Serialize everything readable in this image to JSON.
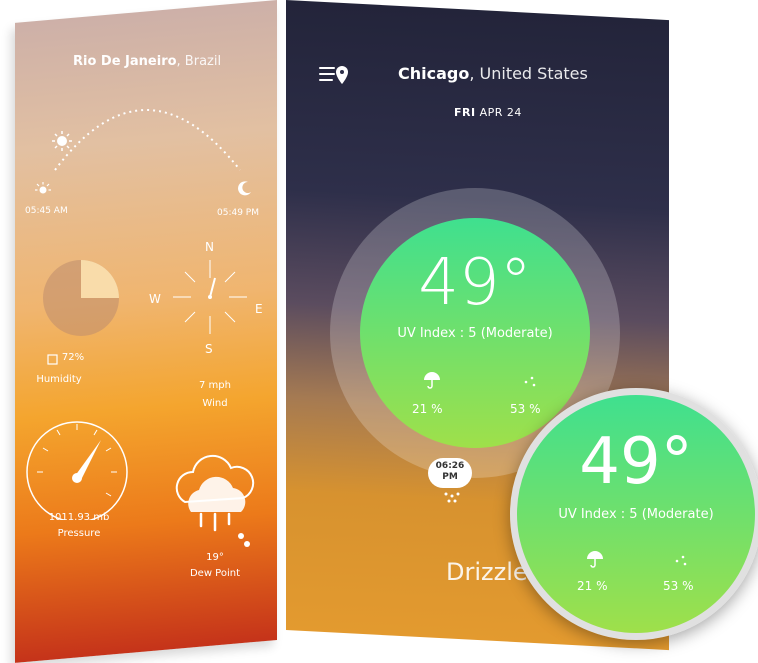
{
  "left": {
    "city": "Rio De Janeiro",
    "country": ", Brazil",
    "sunrise": "05:45 AM",
    "sunset": "05:49 PM",
    "humidity_value": "72%",
    "humidity_label": "Humidity",
    "wind_value": "7 mph",
    "wind_label": "Wind",
    "compass": {
      "n": "N",
      "s": "S",
      "e": "E",
      "w": "W"
    },
    "pressure_value": "1011.93 mb",
    "pressure_label": "Pressure",
    "dew_value": "19°",
    "dew_label": "Dew Point"
  },
  "right": {
    "city": "Chicago",
    "country": ", United States",
    "day": "FRI",
    "date": "APR 24",
    "temperature": "49°",
    "uv": "UV Index : 5 (Moderate)",
    "precip_pct": "21 %",
    "humidity_pct": "53 %",
    "time_line1": "06:26",
    "time_line2": "PM",
    "condition": "Drizzle"
  },
  "magnifier": {
    "temperature": "49°",
    "uv": "UV Index : 5 (Moderate)",
    "precip_pct": "21 %",
    "humidity_pct": "53 %"
  },
  "icons": [
    "menu-location-icon",
    "sun-icon",
    "moon-icon",
    "umbrella-icon",
    "raindrops-icon",
    "cloud-rain-icon",
    "compass-icon",
    "gauge-icon",
    "pie-chart-icon"
  ]
}
